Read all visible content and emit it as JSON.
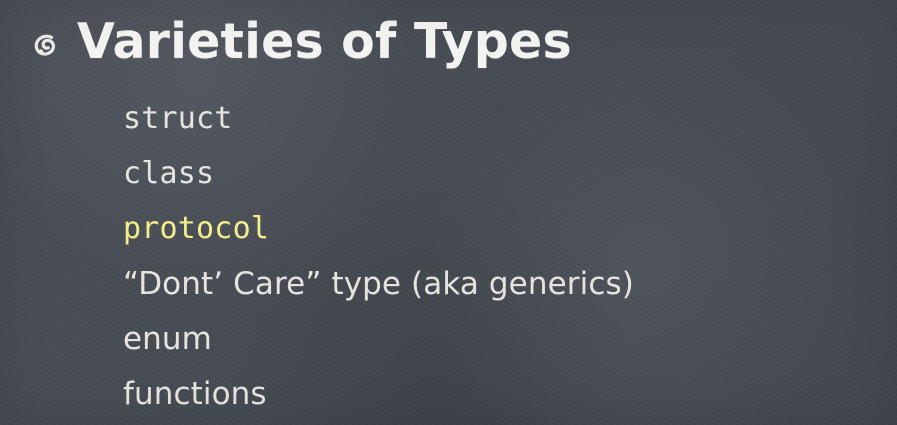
{
  "slide": {
    "title": "Varieties of Types",
    "bullet_icon": "chalk-swirl-icon",
    "items": [
      {
        "text": "struct",
        "style": "mono"
      },
      {
        "text": "class",
        "style": "mono"
      },
      {
        "text": "protocol",
        "style": "mono"
      },
      {
        "text": "“Dont’ Care” type (aka generics)",
        "style": "sans"
      },
      {
        "text": "enum",
        "style": "sans"
      },
      {
        "text": "functions",
        "style": "sans"
      }
    ],
    "colors": {
      "background": "#474c54",
      "title": "#f3f3f1",
      "text": "#e6e4df",
      "highlight": "#f4ef8a"
    }
  }
}
